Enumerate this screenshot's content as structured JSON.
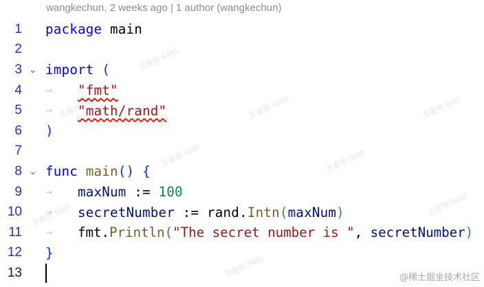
{
  "codelens": "wangkechun, 2 weeks ago | 1 author (wangkechun)",
  "lines": [
    {
      "n": "1"
    },
    {
      "n": "2"
    },
    {
      "n": "3"
    },
    {
      "n": "4"
    },
    {
      "n": "5"
    },
    {
      "n": "6"
    },
    {
      "n": "7"
    },
    {
      "n": "8"
    },
    {
      "n": "9"
    },
    {
      "n": "10"
    },
    {
      "n": "11"
    },
    {
      "n": "12"
    },
    {
      "n": "13"
    }
  ],
  "tokens": {
    "l1_package": "package",
    "l1_main": "main",
    "l3_import": "import",
    "l3_paren": "(",
    "l4_str": "\"fmt\"",
    "l5_str": "\"math/rand\"",
    "l6_paren": ")",
    "l8_func": "func",
    "l8_main": "main",
    "l8_parens": "()",
    "l8_brace": "{",
    "l9_var": "maxNum",
    "l9_op": " := ",
    "l9_num": "100",
    "l10_var": "secretNumber",
    "l10_op": " := ",
    "l10_pkg": "rand",
    "l10_dot": ".",
    "l10_fn": "Intn",
    "l10_open": "(",
    "l10_arg": "maxNum",
    "l10_close": ")",
    "l11_pkg": "fmt",
    "l11_dot": ".",
    "l11_fn": "Println",
    "l11_open": "(",
    "l11_str": "\"The secret number is \"",
    "l11_comma": ", ",
    "l11_arg": "secretNumber",
    "l11_close": ")",
    "l12_brace": "}"
  },
  "watermark_text": "王者牧 5480",
  "brand_watermark": "@稀土掘金技术社区",
  "icons": {
    "fold": "chevron-down-icon",
    "tab_guide": "arrow-right-icon"
  }
}
